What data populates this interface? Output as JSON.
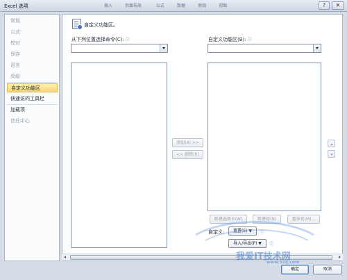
{
  "window": {
    "title": "Excel 选项",
    "background_tabs": [
      "插入",
      "页面布局",
      "公式",
      "数据",
      "审阅",
      "视图"
    ],
    "accent": "#f8d96f"
  },
  "sidebar": {
    "items": [
      {
        "label": "常规",
        "enabled": false
      },
      {
        "label": "公式",
        "enabled": false
      },
      {
        "label": "校对",
        "enabled": false
      },
      {
        "label": "保存",
        "enabled": false
      },
      {
        "label": "语言",
        "enabled": false
      },
      {
        "label": "高级",
        "enabled": false
      },
      {
        "label": "自定义功能区",
        "enabled": true,
        "selected": true
      },
      {
        "label": "快速访问工具栏",
        "enabled": true
      },
      {
        "label": "加载项",
        "enabled": true
      },
      {
        "label": "信任中心",
        "enabled": false
      }
    ]
  },
  "main": {
    "header": {
      "icon": "customize-ribbon-icon",
      "text": "自定义功能区。"
    },
    "left_column": {
      "label": "从下列位置选择命令(C):",
      "combo_value": ""
    },
    "right_column": {
      "label": "自定义功能区(B):",
      "combo_value": ""
    },
    "add_button": "添加(A) >>",
    "remove_button": "<< 删除(R)",
    "new_tab_button": "新建选项卡(W)",
    "new_group_button": "新建组(N)",
    "rename_button": "重命名(M)...",
    "customize_label": "自定义:",
    "reset_button": "重置(E) ▼",
    "import_export_button": "导入/导出(P) ▼",
    "info_icon": "ⓘ"
  },
  "footer": {
    "ok_button": "确定",
    "cancel_button": "取消"
  },
  "watermark": {
    "main": "我爱IT技术网",
    "sub": "www.52ij.com"
  }
}
